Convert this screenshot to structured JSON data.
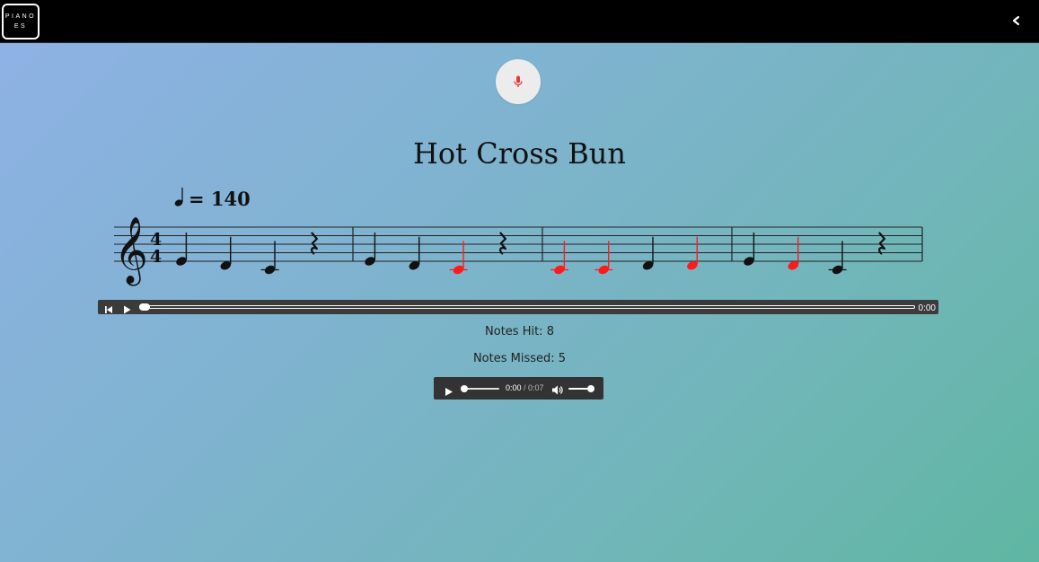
{
  "header": {
    "logo_line1": "PIANO",
    "logo_line2": "ES",
    "back_icon": "chevron-left-icon"
  },
  "mic": {
    "icon": "microphone-icon",
    "color": "#e03a3a"
  },
  "song": {
    "title": "Hot Cross Bun",
    "tempo_value": "= 140",
    "time_signature": {
      "top": "4",
      "bottom": "4"
    },
    "clef": "treble",
    "measures": [
      [
        {
          "type": "note",
          "pitch": "E4",
          "status": "hit"
        },
        {
          "type": "note",
          "pitch": "D4",
          "status": "hit"
        },
        {
          "type": "note",
          "pitch": "C4",
          "status": "hit"
        },
        {
          "type": "rest"
        }
      ],
      [
        {
          "type": "note",
          "pitch": "E4",
          "status": "hit"
        },
        {
          "type": "note",
          "pitch": "D4",
          "status": "hit"
        },
        {
          "type": "note",
          "pitch": "C4",
          "status": "missed"
        },
        {
          "type": "rest"
        }
      ],
      [
        {
          "type": "note",
          "pitch": "C4",
          "status": "missed"
        },
        {
          "type": "note",
          "pitch": "C4",
          "status": "missed"
        },
        {
          "type": "note",
          "pitch": "D4",
          "status": "hit"
        },
        {
          "type": "note",
          "pitch": "D4",
          "status": "missed"
        }
      ],
      [
        {
          "type": "note",
          "pitch": "E4",
          "status": "hit"
        },
        {
          "type": "note",
          "pitch": "D4",
          "status": "missed"
        },
        {
          "type": "note",
          "pitch": "C4",
          "status": "hit"
        },
        {
          "type": "rest"
        }
      ]
    ]
  },
  "colors": {
    "note_hit": "#111111",
    "note_missed": "#ff1a1a"
  },
  "score_player": {
    "prev_icon": "skip-back-icon",
    "play_icon": "play-icon",
    "time": "0:00",
    "progress": 0
  },
  "stats": {
    "hit_label": "Notes Hit: 8",
    "missed_label": "Notes Missed: 5"
  },
  "audio": {
    "play_icon": "play-icon",
    "current": "0:00",
    "separator": " / ",
    "duration": "0:07",
    "progress": 0,
    "volume_icon": "volume-icon",
    "volume": 1.0
  }
}
